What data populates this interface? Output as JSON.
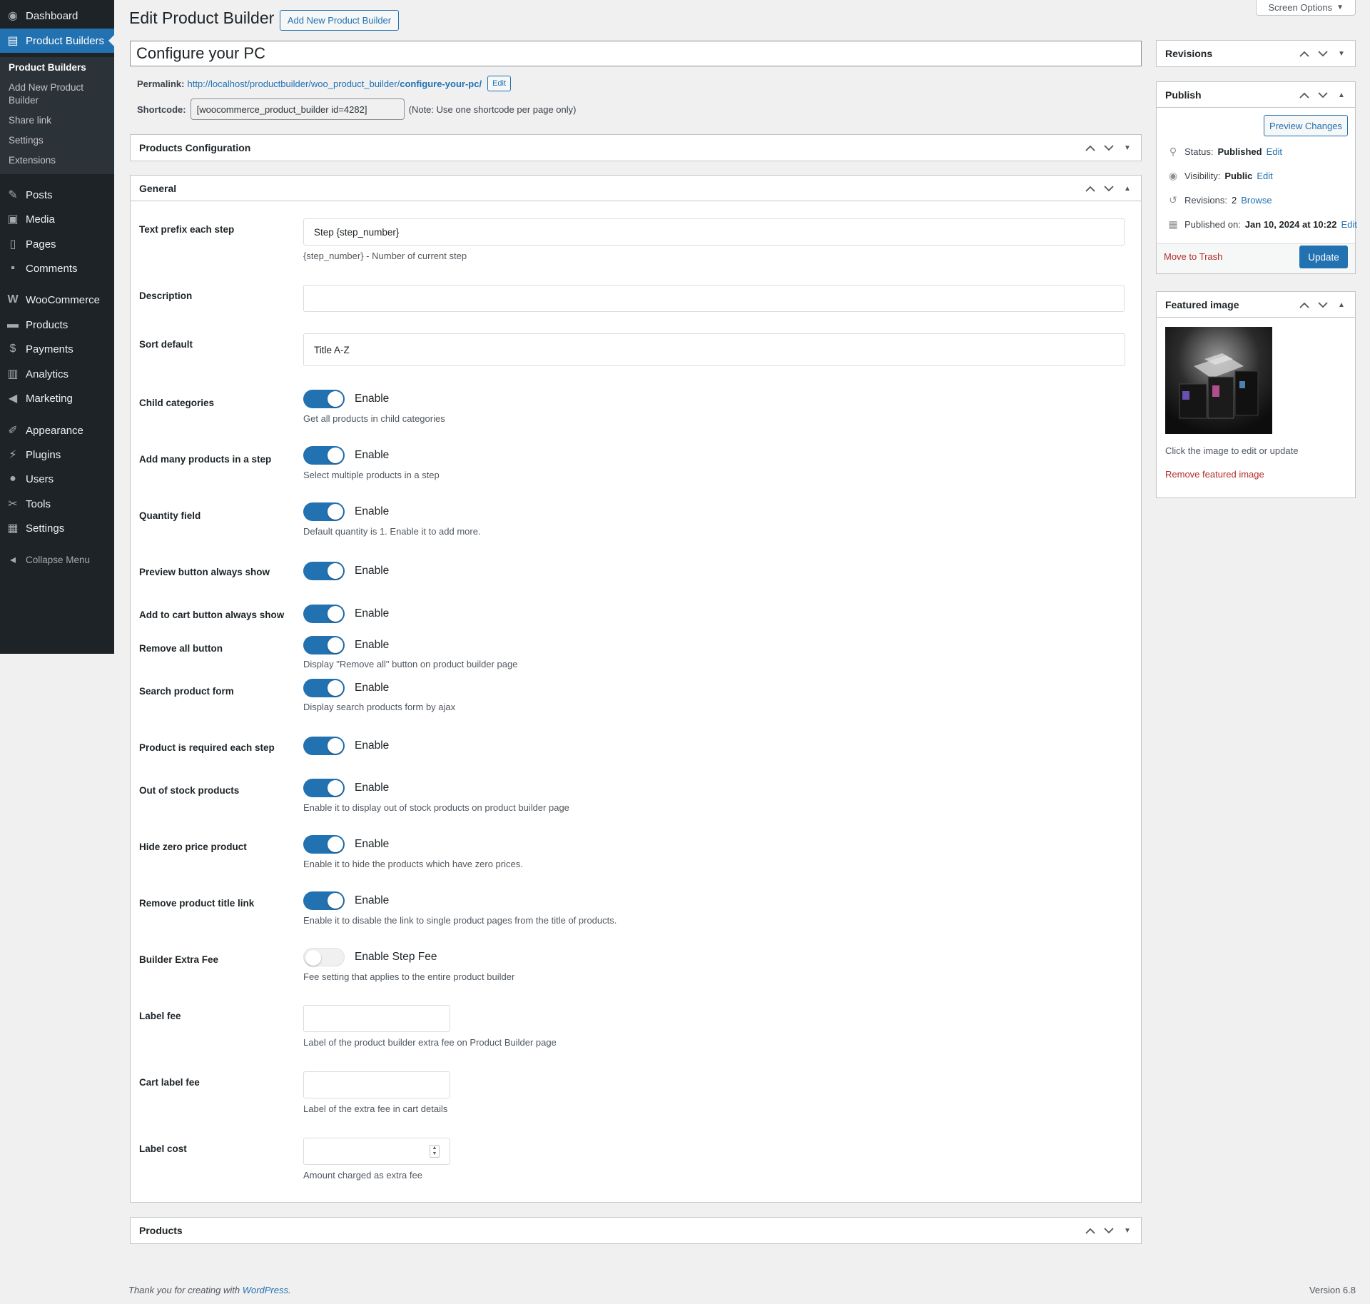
{
  "sidebar": {
    "items": [
      {
        "label": "Dashboard",
        "icon": "dashboard-icon"
      },
      {
        "label": "Product Builders",
        "icon": "product-builders-icon"
      },
      {
        "label": "Posts",
        "icon": "pin-icon"
      },
      {
        "label": "Media",
        "icon": "media-icon"
      },
      {
        "label": "Pages",
        "icon": "pages-icon"
      },
      {
        "label": "Comments",
        "icon": "comments-icon"
      },
      {
        "label": "WooCommerce",
        "icon": "woocommerce-icon"
      },
      {
        "label": "Products",
        "icon": "archive-icon"
      },
      {
        "label": "Payments",
        "icon": "payments-icon"
      },
      {
        "label": "Analytics",
        "icon": "analytics-icon"
      },
      {
        "label": "Marketing",
        "icon": "megaphone-icon"
      },
      {
        "label": "Appearance",
        "icon": "brush-icon"
      },
      {
        "label": "Plugins",
        "icon": "plugin-icon"
      },
      {
        "label": "Users",
        "icon": "user-icon"
      },
      {
        "label": "Tools",
        "icon": "wrench-icon"
      },
      {
        "label": "Settings",
        "icon": "settings-icon"
      }
    ],
    "submenu": [
      "Product Builders",
      "Add New Product Builder",
      "Share link",
      "Settings",
      "Extensions"
    ],
    "collapse_label": "Collapse Menu"
  },
  "header": {
    "screen_options": "Screen Options",
    "title": "Edit Product Builder",
    "add_new_label": "Add New Product Builder"
  },
  "post": {
    "title": "Configure your PC",
    "permalink_label": "Permalink:",
    "permalink_base": "http://localhost/productbuilder/woo_product_builder/",
    "permalink_slug": "configure-your-pc/",
    "permalink_edit": "Edit",
    "shortcode_label": "Shortcode:",
    "shortcode_value": "[woocommerce_product_builder id=4282]",
    "shortcode_note": "(Note: Use one shortcode per page only)"
  },
  "boxes": {
    "products_configuration": "Products Configuration",
    "general": "General",
    "products": "Products"
  },
  "general": {
    "text_prefix": {
      "label": "Text prefix each step",
      "value": "Step {step_number}",
      "help": "{step_number} - Number of current step"
    },
    "description": {
      "label": "Description",
      "value": ""
    },
    "sort_default": {
      "label": "Sort default",
      "value": "Title A-Z"
    },
    "toggles": [
      {
        "label": "Child categories",
        "toggle": "Enable",
        "on": true,
        "help": "Get all products in child categories"
      },
      {
        "label": "Add many products in a step",
        "toggle": "Enable",
        "on": true,
        "help": "Select multiple products in a step"
      },
      {
        "label": "Quantity field",
        "toggle": "Enable",
        "on": true,
        "help": "Default quantity is 1. Enable it to add more."
      },
      {
        "label": "Preview button always show",
        "toggle": "Enable",
        "on": true,
        "help": ""
      },
      {
        "label": "Add to cart button always show",
        "toggle": "Enable",
        "on": true,
        "help": ""
      },
      {
        "label": "Remove all button",
        "toggle": "Enable",
        "on": true,
        "help": "Display \"Remove all\" button on product builder page"
      },
      {
        "label": "Search product form",
        "toggle": "Enable",
        "on": true,
        "help": "Display search products form by ajax"
      },
      {
        "label": "Product is required each step",
        "toggle": "Enable",
        "on": true,
        "help": ""
      },
      {
        "label": "Out of stock products",
        "toggle": "Enable",
        "on": true,
        "help": "Enable it to display out of stock products on product builder page"
      },
      {
        "label": "Hide zero price product",
        "toggle": "Enable",
        "on": true,
        "help": "Enable it to hide the products which have zero prices."
      },
      {
        "label": "Remove product title link",
        "toggle": "Enable",
        "on": true,
        "help": "Enable it to disable the link to single product pages from the title of products."
      },
      {
        "label": "Builder Extra Fee",
        "toggle": "Enable Step Fee",
        "on": false,
        "help": "Fee setting that applies to the entire product builder"
      }
    ],
    "label_fee": {
      "label": "Label fee",
      "value": "",
      "help": "Label of the product builder extra fee on Product Builder page"
    },
    "cart_label_fee": {
      "label": "Cart label fee",
      "value": "",
      "help": "Label of the extra fee in cart details"
    },
    "label_cost": {
      "label": "Label cost",
      "value": "",
      "help": "Amount charged as extra fee"
    }
  },
  "revisions_box": {
    "title": "Revisions"
  },
  "publish_box": {
    "title": "Publish",
    "preview_changes": "Preview Changes",
    "status_label": "Status:",
    "status_value": "Published",
    "visibility_label": "Visibility:",
    "visibility_value": "Public",
    "revisions_label": "Revisions:",
    "revisions_value": "2",
    "browse": "Browse",
    "published_label": "Published on:",
    "published_value": "Jan 10, 2024 at 10:22",
    "edit": "Edit",
    "move_to_trash": "Move to Trash",
    "update": "Update"
  },
  "featured_box": {
    "title": "Featured image",
    "hint": "Click the image to edit or update",
    "remove": "Remove featured image"
  },
  "footer": {
    "thanks_prefix": "Thank you for creating with",
    "wordpress": "WordPress",
    "thanks_suffix": ".",
    "version": "Version 6.8"
  },
  "colors": {
    "accent": "#2271b1",
    "sidebar": "#1d2327",
    "danger": "#b32d2e"
  }
}
